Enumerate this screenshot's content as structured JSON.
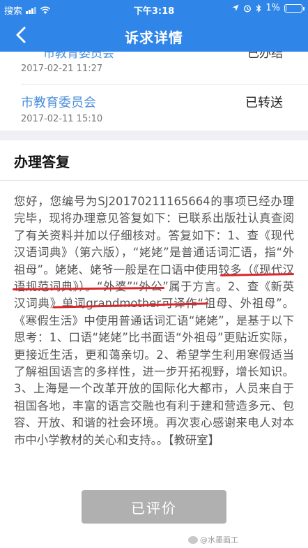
{
  "status_bar": {
    "carrier": "搜索",
    "time": "下午3:18",
    "battery": "1%",
    "battery_level": 0.01
  },
  "navbar": {
    "title": "诉求详情"
  },
  "records": [
    {
      "dept": "市教育委员会",
      "status": "已办结",
      "time": "2017-02-21 11:27"
    },
    {
      "dept": "市教育委员会",
      "status": "已转送",
      "time": "2017-02-11 15:10"
    }
  ],
  "section": {
    "title": "办理答复"
  },
  "reply": {
    "text": "您好，您编号为SJ20170211165664的事项已经办理完毕，现将办理意见答复如下：已联系出版社认真查阅了有关资料并加以仔细核对。答复如下：1、查《现代汉语词典》（第六版），“姥姥”是普通话词汇语，指“外祖母”。姥姥、姥爷一般是在口语中使用较多（《现代汉语规范词典》）。“外婆”“外公”属于方言。2、查《新英汉词典》单词grandmother可译作“祖母、外祖母”。《寒假生活》中使用普通话词汇语“姥姥”，是基于以下思考：1、口语“姥姥”比书面语“外祖母”更贴近实际，更接近生活，更和蔼亲切。2、希望学生利用寒假适当了解祖国语言的多样性，进一步开拓视野，增长知识。3、上海是一个改革开放的国际化大都市，人员来自于祖国各地，丰富的语言交融也有利于建和营造多元、包容、开放、和谐的社会环境。再次衷心感谢来电人对本市中小学教材的关心和支持。。【教研室】"
  },
  "button": {
    "label": "已评价"
  },
  "watermark": {
    "text": "@水墨画工"
  },
  "colors": {
    "header": "#2f86e8",
    "link": "#4a8fd8",
    "annotation": "#d9262c",
    "button_disabled": "#b0b0b0"
  }
}
